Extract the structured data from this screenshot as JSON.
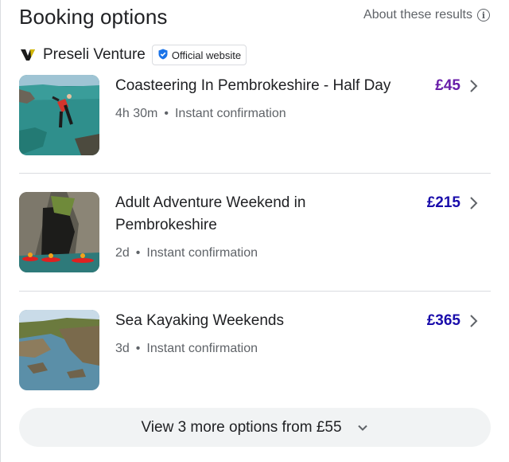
{
  "header": {
    "title": "Booking options",
    "about_label": "About these results",
    "about_icon": "info-icon"
  },
  "provider": {
    "name": "Preseli Venture",
    "badge_label": "Official website",
    "badge_icon": "verified-shield-icon",
    "badge_color": "#1a73e8"
  },
  "options": [
    {
      "title": "Coasteering In Pembrokeshire - Half Day",
      "price": "£45",
      "price_color": "#681da8",
      "duration": "4h 30m",
      "separator": "•",
      "confirmation": "Instant confirmation"
    },
    {
      "title": "Adult Adventure Weekend in Pembrokeshire",
      "price": "£215",
      "price_color": "#1a0dab",
      "duration": "2d",
      "separator": "•",
      "confirmation": "Instant confirmation"
    },
    {
      "title": "Sea Kayaking Weekends",
      "price": "£365",
      "price_color": "#1a0dab",
      "duration": "3d",
      "separator": "•",
      "confirmation": "Instant confirmation"
    }
  ],
  "more": {
    "label": "View 3 more options from £55",
    "icon": "chevron-down-icon"
  }
}
